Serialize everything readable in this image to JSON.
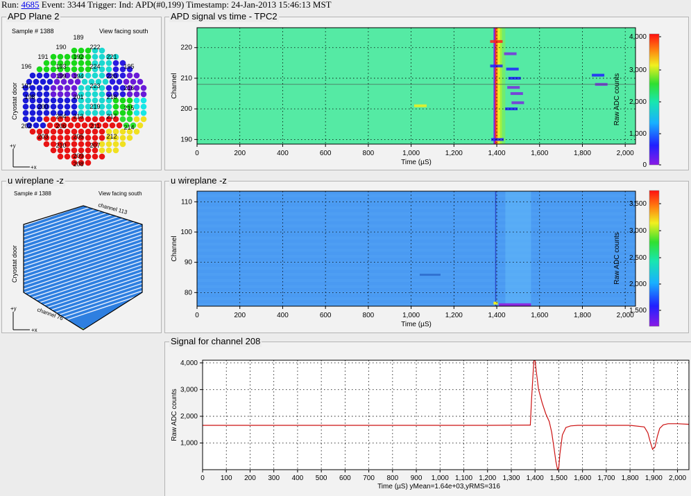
{
  "header": {
    "run_label": "Run:",
    "run_number": "4685",
    "rest": " Event: 3344 Trigger: Ind: APD(#0,199) Timestamp: 24-Jan-2013 15:46:13 MST"
  },
  "apd_plane": {
    "title": "APD Plane 2",
    "sample": "Sample # 1388",
    "view": "View facing south",
    "side_label": "Cryostat door",
    "axis_y": "+y",
    "axis_x": "+x",
    "channel_labels": [
      "189",
      "190",
      "222",
      "191",
      "192",
      "221",
      "193",
      "194",
      "224",
      "196",
      "195",
      "220",
      "216",
      "197",
      "199",
      "201",
      "223",
      "218",
      "198",
      "200",
      "219",
      "215",
      "202",
      "204",
      "206",
      "213",
      "217",
      "214",
      "203",
      "205",
      "211",
      "212",
      "210",
      "207",
      "209",
      "208"
    ]
  },
  "u_plane": {
    "title": "u wireplane -z",
    "sample": "Sample # 1388",
    "view": "View facing south",
    "side_label": "Cryostat door",
    "axis_y": "+y",
    "axis_x": "+x",
    "channel_top": "channel 113",
    "channel_bottom": "channel 76"
  },
  "colors": {
    "heatmap_bg_apd": "#55eaa4",
    "heatmap_bg_u": "#4a9af2",
    "signal_line": "#cc1111"
  },
  "chart_data": [
    {
      "type": "heatmap",
      "title": "APD signal vs time - TPC2",
      "xlabel": "Time (µS)",
      "ylabel": "Channel",
      "xlim": [
        0,
        2048
      ],
      "ylim": [
        188.5,
        226.5
      ],
      "xticks": [
        "0",
        "200",
        "400",
        "600",
        "800",
        "1,000",
        "1,200",
        "1,400",
        "1,600",
        "1,800",
        "2,000"
      ],
      "yticks": [
        "190",
        "200",
        "210",
        "220"
      ],
      "colorbar": {
        "label": "Raw ADC counts",
        "range": [
          0,
          4100
        ],
        "ticks": [
          "0",
          "1,000",
          "2,000",
          "3,000",
          "4,000"
        ]
      },
      "grid": true
    },
    {
      "type": "heatmap",
      "title": "u wireplane -z",
      "xlabel": "Time (µS)",
      "ylabel": "Channel",
      "xlim": [
        0,
        2048
      ],
      "ylim": [
        75.5,
        113.5
      ],
      "xticks": [
        "0",
        "200",
        "400",
        "600",
        "800",
        "1,000",
        "1,200",
        "1,400",
        "1,600",
        "1,800",
        "2,000"
      ],
      "yticks": [
        "80",
        "90",
        "100",
        "110"
      ],
      "colorbar": {
        "label": "Raw ADC counts",
        "range": [
          1250,
          3800
        ],
        "ticks": [
          "1,500",
          "2,000",
          "2,500",
          "3,000",
          "3,500"
        ]
      },
      "grid": true
    },
    {
      "type": "line",
      "title": "Signal for channel 208",
      "xlabel": "Time (µS)  yMean=1.64e+03,yRMS=316",
      "ylabel": "Raw ADC counts",
      "xlim": [
        0,
        2048
      ],
      "ylim": [
        0,
        4100
      ],
      "xticks": [
        "0",
        "100",
        "200",
        "300",
        "400",
        "500",
        "600",
        "700",
        "800",
        "900",
        "1,000",
        "1,100",
        "1,200",
        "1,300",
        "1,400",
        "1,500",
        "1,600",
        "1,700",
        "1,800",
        "1,900",
        "2,000"
      ],
      "yticks": [
        "1,000",
        "2,000",
        "3,000",
        "4,000"
      ],
      "grid": true,
      "series": [
        {
          "x": [
            0,
            300,
            600,
            900,
            1200,
            1380,
            1385,
            1395,
            1400,
            1405,
            1415,
            1430,
            1445,
            1460,
            1470,
            1480,
            1488,
            1495,
            1500,
            1505,
            1515,
            1530,
            1550,
            1580,
            1620,
            1700,
            1800,
            1860,
            1875,
            1885,
            1895,
            1905,
            1915,
            1925,
            1940,
            1960,
            2000,
            2048
          ],
          "y": [
            1660,
            1660,
            1660,
            1660,
            1660,
            1670,
            2600,
            4090,
            4090,
            3700,
            3000,
            2500,
            2100,
            1800,
            1400,
            800,
            300,
            0,
            80,
            600,
            1300,
            1580,
            1640,
            1660,
            1660,
            1660,
            1660,
            1600,
            1380,
            1050,
            760,
            850,
            1250,
            1550,
            1680,
            1720,
            1720,
            1700
          ]
        }
      ]
    }
  ]
}
